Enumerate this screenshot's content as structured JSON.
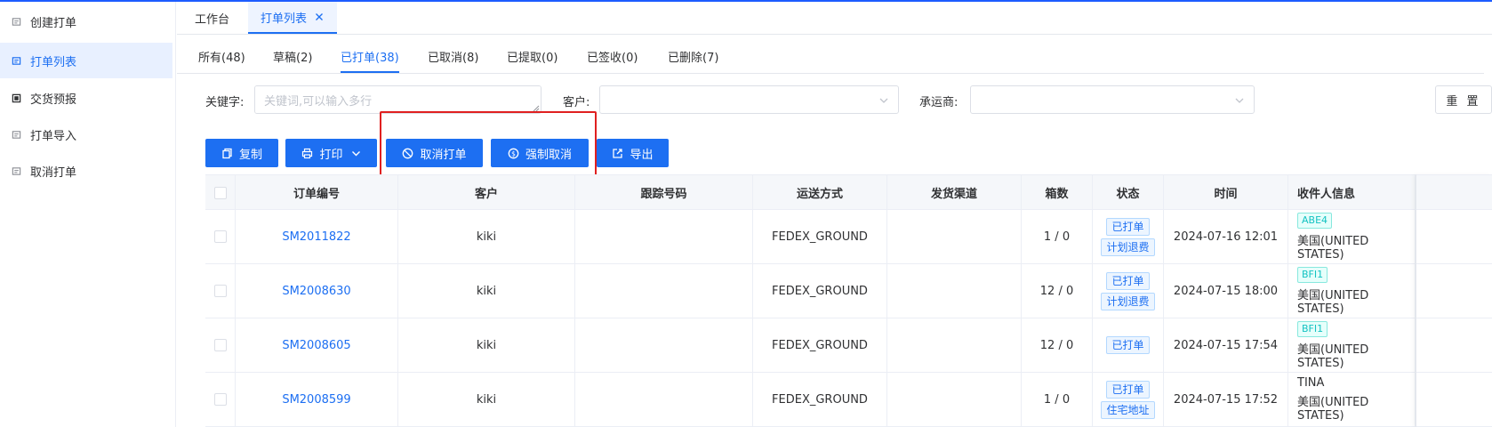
{
  "colors": {
    "primary": "#1d6ff2",
    "highlight": "#e02020",
    "tag_cyan": "#13c2c2"
  },
  "sidebar": {
    "items": [
      {
        "label": "创建打单",
        "icon": "document-icon",
        "active": false
      },
      {
        "label": "打单列表",
        "icon": "document-icon",
        "active": true
      },
      {
        "label": "交货预报",
        "icon": "form-icon",
        "active": false
      },
      {
        "label": "打单导入",
        "icon": "document-icon",
        "active": false
      },
      {
        "label": "取消打单",
        "icon": "document-icon",
        "active": false
      }
    ]
  },
  "window_tabs": [
    {
      "label": "工作台"
    },
    {
      "label": "打单列表",
      "closable": true
    }
  ],
  "status_tabs": [
    {
      "label": "所有(48)"
    },
    {
      "label": "草稿(2)"
    },
    {
      "label": "已打单(38)",
      "active": true
    },
    {
      "label": "已取消(8)"
    },
    {
      "label": "已提取(0)"
    },
    {
      "label": "已签收(0)"
    },
    {
      "label": "已删除(7)"
    }
  ],
  "filters": {
    "keyword_label": "关键字:",
    "keyword_placeholder": "关键词,可以输入多行",
    "customer_label": "客户:",
    "carrier_label": "承运商:",
    "reset_label": "重 置"
  },
  "actions": {
    "copy": "复制",
    "print": "打印",
    "cancel_print": "取消打单",
    "force_cancel": "强制取消",
    "export": "导出"
  },
  "table": {
    "headers": [
      "订单编号",
      "客户",
      "跟踪号码",
      "运送方式",
      "发货渠道",
      "箱数",
      "状态",
      "时间",
      "收件人信息"
    ],
    "rows": [
      {
        "order_no": "SM2011822",
        "customer": "kiki",
        "tracking": "",
        "shipping": "FEDEX_GROUND",
        "channel": "",
        "boxes": "1 / 0",
        "status": [
          "已打单",
          "计划退费"
        ],
        "time": "2024-07-16 12:01",
        "recipient_tag": "ABE4",
        "recipient_name": "",
        "recipient_country": "美国(UNITED STATES)"
      },
      {
        "order_no": "SM2008630",
        "customer": "kiki",
        "tracking": "",
        "shipping": "FEDEX_GROUND",
        "channel": "",
        "boxes": "12 / 0",
        "status": [
          "已打单",
          "计划退费"
        ],
        "time": "2024-07-15 18:00",
        "recipient_tag": "BFI1",
        "recipient_name": "",
        "recipient_country": "美国(UNITED STATES)"
      },
      {
        "order_no": "SM2008605",
        "customer": "kiki",
        "tracking": "",
        "shipping": "FEDEX_GROUND",
        "channel": "",
        "boxes": "12 / 0",
        "status": [
          "已打单"
        ],
        "time": "2024-07-15 17:54",
        "recipient_tag": "BFI1",
        "recipient_name": "",
        "recipient_country": "美国(UNITED STATES)"
      },
      {
        "order_no": "SM2008599",
        "customer": "kiki",
        "tracking": "",
        "shipping": "FEDEX_GROUND",
        "channel": "",
        "boxes": "1 / 0",
        "status": [
          "已打单",
          "住宅地址"
        ],
        "time": "2024-07-15 17:52",
        "recipient_tag": "",
        "recipient_name": "TINA",
        "recipient_country": "美国(UNITED STATES)"
      }
    ]
  }
}
